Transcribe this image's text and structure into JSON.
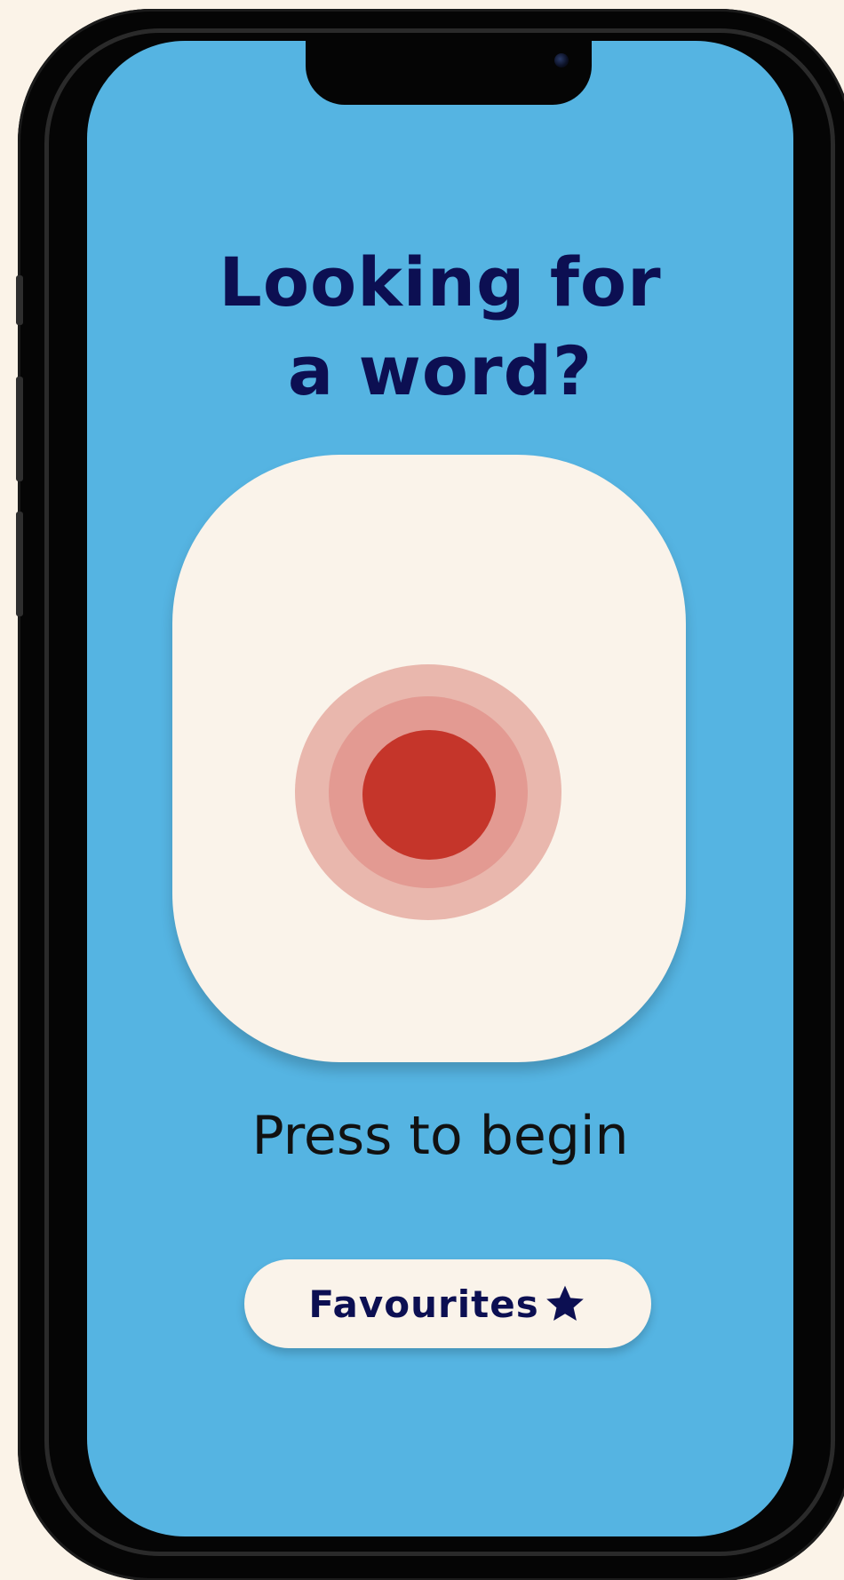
{
  "app": {
    "heading_line1": "Looking for",
    "heading_line2": "a word?",
    "record_button_icon": "record-dot-icon",
    "prompt": "Press to begin",
    "favourites_label": "Favourites",
    "favourites_icon": "star-icon"
  },
  "colors": {
    "background": "#fbf3e8",
    "screen": "#55b4e2",
    "card": "#faf3ea",
    "heading": "#0c0f52",
    "record_outer": "#e9b7ad",
    "record_mid": "#e39a92",
    "record_dot": "#c5352a"
  }
}
